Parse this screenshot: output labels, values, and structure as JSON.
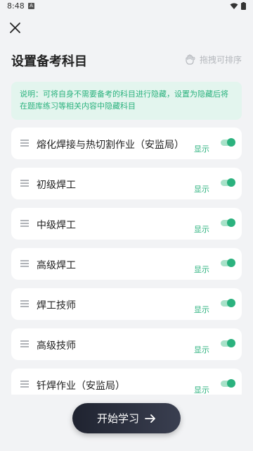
{
  "status_bar": {
    "time": "8:48",
    "notification_letter": "A"
  },
  "header": {
    "title": "设置备考科目",
    "drag_hint": "拖拽可排序"
  },
  "notice": {
    "text": "说明：可将自身不需要备考的科目进行隐藏，设置为隐藏后将在题库练习等相关内容中隐藏科目"
  },
  "subjects": [
    {
      "label": "熔化焊接与热切割作业（安监局）",
      "status": "显示",
      "enabled": true
    },
    {
      "label": "初级焊工",
      "status": "显示",
      "enabled": true
    },
    {
      "label": "中级焊工",
      "status": "显示",
      "enabled": true
    },
    {
      "label": "高级焊工",
      "status": "显示",
      "enabled": true
    },
    {
      "label": "焊工技师",
      "status": "显示",
      "enabled": true
    },
    {
      "label": "高级技师",
      "status": "显示",
      "enabled": true
    },
    {
      "label": "钎焊作业（安监局）",
      "status": "显示",
      "enabled": true
    }
  ],
  "footer": {
    "start_label": "开始学习"
  },
  "colors": {
    "accent": "#2bb27e",
    "notice_bg": "#e3f5ee",
    "button_bg": "#2a2e3b"
  }
}
